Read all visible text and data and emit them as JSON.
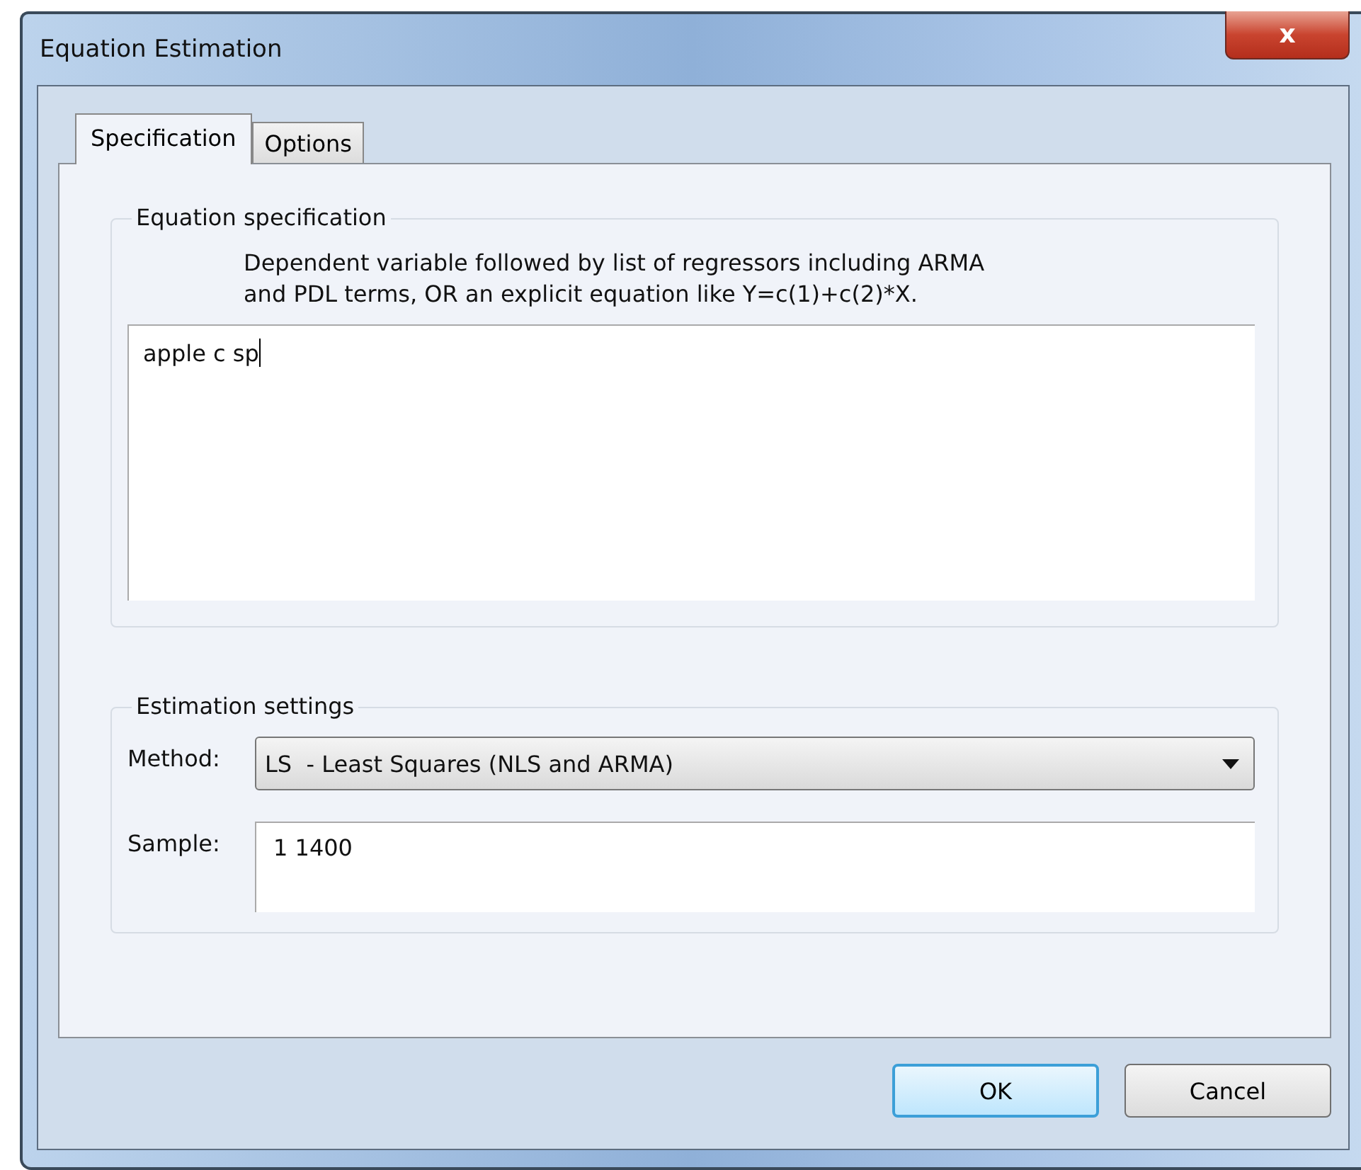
{
  "window": {
    "title": "Equation Estimation",
    "close": "x"
  },
  "tabs": [
    {
      "label": "Specification",
      "selected": true
    },
    {
      "label": "Options",
      "selected": false
    }
  ],
  "equation_specification": {
    "title": "Equation specification",
    "hint": [
      "Dependent variable followed by list of regressors including ARMA",
      "and PDL terms, OR an explicit equation like Y=c(1)+c(2)*X."
    ],
    "value": "apple c sp"
  },
  "estimation_settings": {
    "title": "Estimation settings",
    "method_label": "Method:",
    "method_value": "LS  - Least Squares (NLS and ARMA)",
    "sample_label": "Sample:",
    "sample_value": "1 1400"
  },
  "buttons": [
    {
      "label": "OK",
      "default": true
    },
    {
      "label": "Cancel",
      "default": false
    }
  ]
}
